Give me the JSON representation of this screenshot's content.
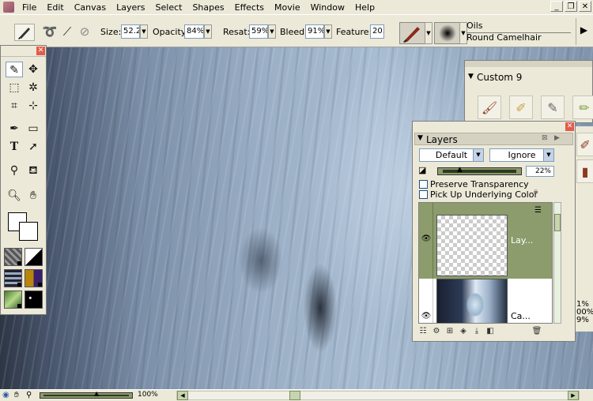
{
  "menubar": {
    "items": [
      "File",
      "Edit",
      "Canvas",
      "Layers",
      "Select",
      "Shapes",
      "Effects",
      "Movie",
      "Window",
      "Help"
    ],
    "window_controls": [
      "_",
      "❐",
      "✕"
    ]
  },
  "property_bar": {
    "size_label": "Size:",
    "size_value": "52.2",
    "opacity_label": "Opacity:",
    "opacity_value": "84%",
    "resat_label": "Resat:",
    "resat_value": "59%",
    "bleed_label": "Bleed:",
    "bleed_value": "91%",
    "feature_label": "Feature:",
    "feature_value": "20.",
    "brush_category": "Oils",
    "brush_variant": "Round Camelhair"
  },
  "custom_palette": {
    "title": "Custom  9",
    "brush_count": 5
  },
  "layers_palette": {
    "title": "Layers",
    "composite_method": "Default",
    "composite_depth": "Ignore",
    "opacity": "22%",
    "opacity_fraction": 0.22,
    "preserve_transparency_label": "Preserve Transparency",
    "preserve_transparency_checked": false,
    "pick_up_label": "Pick Up Underlying Color",
    "pick_up_checked": false,
    "layers": [
      {
        "name": "Lay...",
        "selected": true,
        "visible": true,
        "thumb": "checker"
      },
      {
        "name": "Ca...",
        "selected": false,
        "visible": true,
        "thumb": "photo"
      }
    ]
  },
  "right_edge": {
    "values": [
      "1%",
      "00%",
      "9%"
    ]
  },
  "statusbar": {
    "zoom": "100%"
  },
  "colors": {
    "panel_bg": "#ece9d8",
    "selected_layer": "#8c9c6c",
    "close_button": "#e35b4a"
  },
  "icons": [
    "brush-icon",
    "selection-adjuster-icon",
    "crop-icon",
    "pen-icon",
    "rectangle-shape-icon",
    "text-icon",
    "shape-selection-icon",
    "dropper-icon",
    "paint-bucket-icon",
    "magnifier-icon",
    "grabber-hand-icon"
  ]
}
